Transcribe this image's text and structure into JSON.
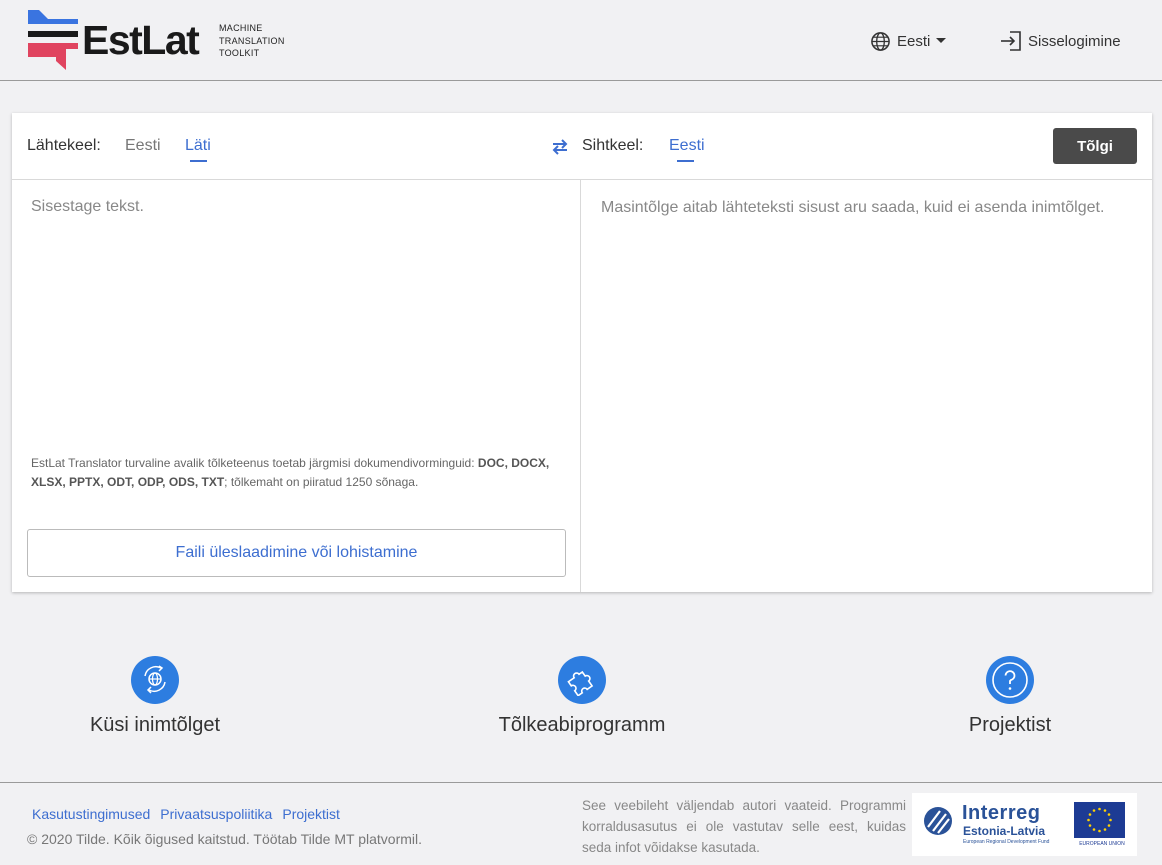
{
  "header": {
    "logo_text": "EstLat",
    "logo_sub": [
      "MACHINE",
      "TRANSLATION",
      "TOOLKIT"
    ],
    "language_menu": "Eesti",
    "login": "Sisselogimine"
  },
  "translator": {
    "source_label": "Lähtekeel:",
    "source_languages": [
      {
        "label": "Eesti",
        "active": false
      },
      {
        "label": "Läti",
        "active": true
      }
    ],
    "target_label": "Sihtkeel:",
    "target_language": "Eesti",
    "translate_button": "Tõlgi",
    "source_placeholder": "Sisestage tekst.",
    "target_placeholder": "Masintõlge aitab lähteteksti sisust aru saada, kuid ei asenda inimtõlget.",
    "doc_info_prefix": "EstLat Translator turvaline avalik tõlketeenus toetab järgmisi dokumendivorminguid: ",
    "doc_formats": "DOC, DOCX, XLSX, PPTX, ODT, ODP, ODS, TXT",
    "doc_info_suffix": "; tõlkemaht on piiratud 1250 sõnaga.",
    "upload_button": "Faili üleslaadimine või lohistamine"
  },
  "features": [
    {
      "label": "Küsi inimtõlget",
      "icon": "globe-chat-icon"
    },
    {
      "label": "Tõlkeabiprogramm",
      "icon": "puzzle-icon"
    },
    {
      "label": "Projektist",
      "icon": "question-icon"
    }
  ],
  "footer": {
    "links": [
      "Kasutustingimused",
      "Privaatsuspoliitika",
      "Projektist"
    ],
    "copyright": "© 2020 Tilde. Kõik õigused kaitstud. Töötab Tilde MT platvormil.",
    "disclaimer": "See veebileht väljendab autori vaateid. Programmi korraldusasutus ei ole vastutav selle eest, kuidas seda infot võidakse kasutada.",
    "sponsor": {
      "name": "Interreg",
      "region": "Estonia-Latvia",
      "fund": "European Regional Development Fund",
      "eu": "EUROPEAN UNION"
    }
  },
  "colors": {
    "accent": "#3d6ed0",
    "icon_circle": "#2d7de0",
    "button_dark": "#4a4a4a",
    "background": "#f1f1f3",
    "logo_blue": "#3a74e0",
    "logo_red": "#e0445f"
  }
}
